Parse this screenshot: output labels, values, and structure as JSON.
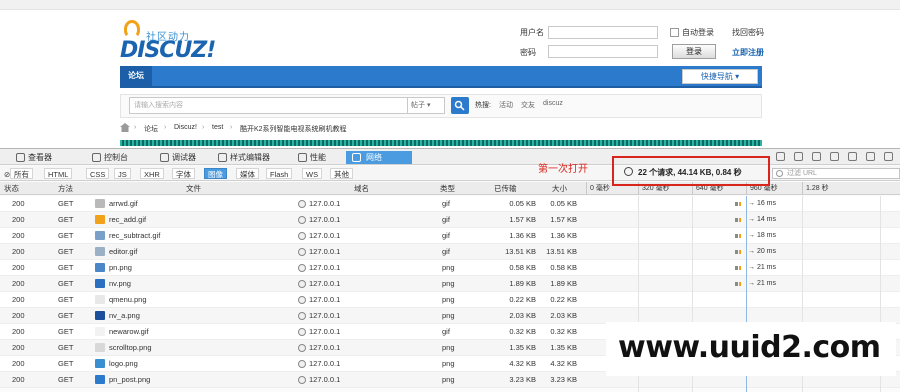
{
  "site": {
    "logo_slogan": "社区动力",
    "logo_word": "DISCUZ!",
    "login": {
      "username_label": "用户名",
      "password_label": "密码",
      "auto_login": "自动登录",
      "forgot": "找回密码",
      "login_button": "登录",
      "register": "立即注册"
    },
    "nav": {
      "forum": "论坛",
      "quick_nav": "快捷导航 ▾"
    },
    "search": {
      "placeholder": "请输入搜索内容",
      "type": "帖子 ▾",
      "hot_label": "热搜:",
      "hot": [
        "活动",
        "交友",
        "discuz"
      ]
    },
    "breadcrumb": [
      "论坛",
      "Discuz!",
      "test",
      "酷开K2系列智能电视系统刷机教程"
    ]
  },
  "devtools": {
    "tabs": [
      "查看器",
      "控制台",
      "调试器",
      "样式编辑器",
      "性能",
      "网络"
    ],
    "filters": [
      "所有",
      "HTML",
      "CSS",
      "JS",
      "XHR",
      "字体",
      "图像",
      "媒体",
      "Flash",
      "WS",
      "其他"
    ],
    "url_filter_placeholder": "过滤 URL",
    "header": {
      "status": "状态",
      "method": "方法",
      "file": "文件",
      "domain": "域名",
      "type": "类型",
      "transferred": "已传输",
      "size": "大小"
    },
    "timeline_ticks": [
      "0 毫秒",
      "320 毫秒",
      "640 毫秒",
      "960 毫秒",
      "1.28 秒"
    ],
    "summary": "22 个请求, 44.14 KB, 0.84 秒",
    "note": "第一次打开",
    "rows": [
      {
        "status": "200",
        "method": "GET",
        "file": "arrwd.gif",
        "domain": "127.0.0.1",
        "type": "gif",
        "transferred": "0.05 KB",
        "size": "0.05 KB",
        "time": "→ 16 ms",
        "icon_color": "#b9b9b9"
      },
      {
        "status": "200",
        "method": "GET",
        "file": "rec_add.gif",
        "domain": "127.0.0.1",
        "type": "gif",
        "transferred": "1.57 KB",
        "size": "1.57 KB",
        "time": "→ 14 ms",
        "icon_color": "#f0a21a"
      },
      {
        "status": "200",
        "method": "GET",
        "file": "rec_subtract.gif",
        "domain": "127.0.0.1",
        "type": "gif",
        "transferred": "1.36 KB",
        "size": "1.36 KB",
        "time": "→ 18 ms",
        "icon_color": "#7aa0c8"
      },
      {
        "status": "200",
        "method": "GET",
        "file": "editor.gif",
        "domain": "127.0.0.1",
        "type": "gif",
        "transferred": "13.51 KB",
        "size": "13.51 KB",
        "time": "→ 20 ms",
        "icon_color": "#9bb0c4"
      },
      {
        "status": "200",
        "method": "GET",
        "file": "pn.png",
        "domain": "127.0.0.1",
        "type": "png",
        "transferred": "0.58 KB",
        "size": "0.58 KB",
        "time": "→ 21 ms",
        "icon_color": "#4a86c8"
      },
      {
        "status": "200",
        "method": "GET",
        "file": "nv.png",
        "domain": "127.0.0.1",
        "type": "png",
        "transferred": "1.89 KB",
        "size": "1.89 KB",
        "time": "→ 21 ms",
        "icon_color": "#2b6fbf"
      },
      {
        "status": "200",
        "method": "GET",
        "file": "qmenu.png",
        "domain": "127.0.0.1",
        "type": "png",
        "transferred": "0.22 KB",
        "size": "0.22 KB",
        "time": "",
        "icon_color": "#e8e8e8"
      },
      {
        "status": "200",
        "method": "GET",
        "file": "nv_a.png",
        "domain": "127.0.0.1",
        "type": "png",
        "transferred": "2.03 KB",
        "size": "2.03 KB",
        "time": "",
        "icon_color": "#1c4f9a"
      },
      {
        "status": "200",
        "method": "GET",
        "file": "newarow.gif",
        "domain": "127.0.0.1",
        "type": "gif",
        "transferred": "0.32 KB",
        "size": "0.32 KB",
        "time": "",
        "icon_color": "#f2f2f2"
      },
      {
        "status": "200",
        "method": "GET",
        "file": "scrolltop.png",
        "domain": "127.0.0.1",
        "type": "png",
        "transferred": "1.35 KB",
        "size": "1.35 KB",
        "time": "",
        "icon_color": "#d8d8d8"
      },
      {
        "status": "200",
        "method": "GET",
        "file": "logo.png",
        "domain": "127.0.0.1",
        "type": "png",
        "transferred": "4.32 KB",
        "size": "4.32 KB",
        "time": "",
        "icon_color": "#3a8fd1"
      },
      {
        "status": "200",
        "method": "GET",
        "file": "pn_post.png",
        "domain": "127.0.0.1",
        "type": "png",
        "transferred": "3.23 KB",
        "size": "3.23 KB",
        "time": "",
        "icon_color": "#2b7acb"
      }
    ]
  },
  "watermark": "www.uuid2.com"
}
